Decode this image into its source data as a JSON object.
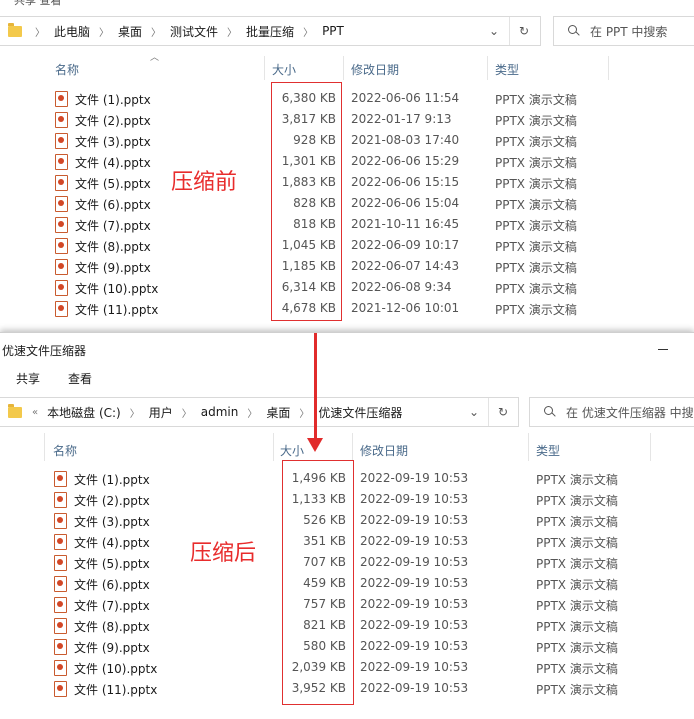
{
  "top_window": {
    "menu_clip": "共享  查看",
    "breadcrumb": [
      "此电脑",
      "桌面",
      "测试文件",
      "批量压缩",
      "PPT"
    ],
    "search_placeholder": "在 PPT 中搜索",
    "columns": {
      "name": "名称",
      "size": "大小",
      "date": "修改日期",
      "type": "类型"
    },
    "label": "压缩前",
    "files": [
      {
        "name": "文件 (1).pptx",
        "size": "6,380 KB",
        "date": "2022-06-06 11:54",
        "type": "PPTX 演示文稿"
      },
      {
        "name": "文件 (2).pptx",
        "size": "3,817 KB",
        "date": "2022-01-17 9:13",
        "type": "PPTX 演示文稿"
      },
      {
        "name": "文件 (3).pptx",
        "size": "928 KB",
        "date": "2021-08-03 17:40",
        "type": "PPTX 演示文稿"
      },
      {
        "name": "文件 (4).pptx",
        "size": "1,301 KB",
        "date": "2022-06-06 15:29",
        "type": "PPTX 演示文稿"
      },
      {
        "name": "文件 (5).pptx",
        "size": "1,883 KB",
        "date": "2022-06-06 15:15",
        "type": "PPTX 演示文稿"
      },
      {
        "name": "文件 (6).pptx",
        "size": "828 KB",
        "date": "2022-06-06 15:04",
        "type": "PPTX 演示文稿"
      },
      {
        "name": "文件 (7).pptx",
        "size": "818 KB",
        "date": "2021-10-11 16:45",
        "type": "PPTX 演示文稿"
      },
      {
        "name": "文件 (8).pptx",
        "size": "1,045 KB",
        "date": "2022-06-09 10:17",
        "type": "PPTX 演示文稿"
      },
      {
        "name": "文件 (9).pptx",
        "size": "1,185 KB",
        "date": "2022-06-07 14:43",
        "type": "PPTX 演示文稿"
      },
      {
        "name": "文件 (10).pptx",
        "size": "6,314 KB",
        "date": "2022-06-08 9:34",
        "type": "PPTX 演示文稿"
      },
      {
        "name": "文件 (11).pptx",
        "size": "4,678 KB",
        "date": "2021-12-06 10:01",
        "type": "PPTX 演示文稿"
      }
    ]
  },
  "bottom_window": {
    "title": "优速文件压缩器",
    "ribbon": [
      "共享",
      "查看"
    ],
    "breadcrumb_prefix": "«",
    "breadcrumb": [
      "本地磁盘 (C:)",
      "用户",
      "admin",
      "桌面",
      "优速文件压缩器"
    ],
    "search_placeholder": "在 优速文件压缩器 中搜",
    "columns": {
      "name": "名称",
      "size": "大小",
      "date": "修改日期",
      "type": "类型"
    },
    "label": "压缩后",
    "files": [
      {
        "name": "文件 (1).pptx",
        "size": "1,496 KB",
        "date": "2022-09-19 10:53",
        "type": "PPTX 演示文稿"
      },
      {
        "name": "文件 (2).pptx",
        "size": "1,133 KB",
        "date": "2022-09-19 10:53",
        "type": "PPTX 演示文稿"
      },
      {
        "name": "文件 (3).pptx",
        "size": "526 KB",
        "date": "2022-09-19 10:53",
        "type": "PPTX 演示文稿"
      },
      {
        "name": "文件 (4).pptx",
        "size": "351 KB",
        "date": "2022-09-19 10:53",
        "type": "PPTX 演示文稿"
      },
      {
        "name": "文件 (5).pptx",
        "size": "707 KB",
        "date": "2022-09-19 10:53",
        "type": "PPTX 演示文稿"
      },
      {
        "name": "文件 (6).pptx",
        "size": "459 KB",
        "date": "2022-09-19 10:53",
        "type": "PPTX 演示文稿"
      },
      {
        "name": "文件 (7).pptx",
        "size": "757 KB",
        "date": "2022-09-19 10:53",
        "type": "PPTX 演示文稿"
      },
      {
        "name": "文件 (8).pptx",
        "size": "821 KB",
        "date": "2022-09-19 10:53",
        "type": "PPTX 演示文稿"
      },
      {
        "name": "文件 (9).pptx",
        "size": "580 KB",
        "date": "2022-09-19 10:53",
        "type": "PPTX 演示文稿"
      },
      {
        "name": "文件 (10).pptx",
        "size": "2,039 KB",
        "date": "2022-09-19 10:53",
        "type": "PPTX 演示文稿"
      },
      {
        "name": "文件 (11).pptx",
        "size": "3,952 KB",
        "date": "2022-09-19 10:53",
        "type": "PPTX 演示文稿"
      }
    ]
  },
  "icons": {
    "folder": "folder-icon",
    "file": "pptx-file-icon",
    "dropdown": "chevron-down-icon",
    "refresh": "refresh-icon",
    "search": "search-icon",
    "arrow": "down-arrow-annotation"
  },
  "colors": {
    "annotation_red": "#e03030",
    "header_text": "#4a6a8a"
  }
}
